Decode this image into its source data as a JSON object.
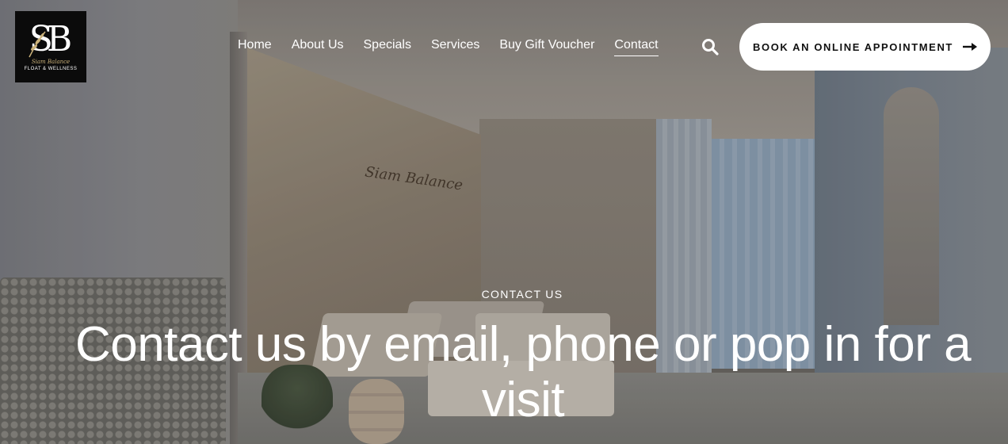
{
  "brand": {
    "logo_letters": "SB",
    "logo_script": "Siam Balance",
    "logo_tagline": "FLOAT & WELLNESS"
  },
  "nav": {
    "items": [
      {
        "label": "Home",
        "active": false
      },
      {
        "label": "About Us",
        "active": false
      },
      {
        "label": "Specials",
        "active": false
      },
      {
        "label": "Services",
        "active": false
      },
      {
        "label": "Buy Gift Voucher",
        "active": false
      },
      {
        "label": "Contact",
        "active": true
      }
    ],
    "search_icon": "search-icon"
  },
  "cta": {
    "label": "BOOK AN ONLINE APPOINTMENT",
    "icon": "arrow-right-icon"
  },
  "hero": {
    "eyebrow": "CONTACT US",
    "headline": "Contact us by email, phone or pop in for a visit",
    "wall_sign": "Siam Balance"
  },
  "colors": {
    "logo_bg": "#0b0b0b",
    "accent_gold": "#cbb27a",
    "cta_bg": "#ffffff",
    "text_light": "#ffffff"
  }
}
